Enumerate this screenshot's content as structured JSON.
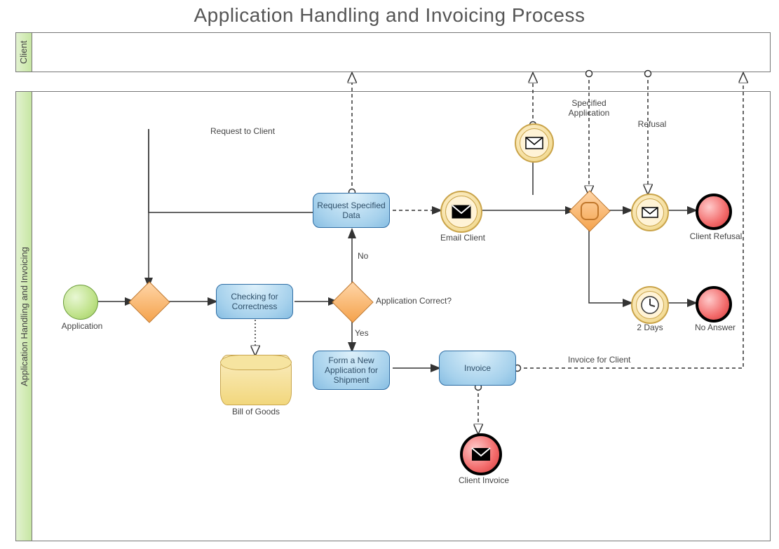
{
  "diagram": {
    "title": "Application Handling and Invoicing Process",
    "lanes": {
      "client": "Client",
      "main": "Application Handling and Invoicing"
    },
    "nodes": {
      "start": {
        "label": "Application"
      },
      "check": {
        "label": "Checking for Correctness"
      },
      "reqdata": {
        "label": "Request Specified Data"
      },
      "formnew": {
        "label": "Form a New Application for Shipment"
      },
      "invoice": {
        "label": "Invoice"
      },
      "billofgoods": {
        "label": "Bill of Goods"
      },
      "emailclient": {
        "label": "Email Client"
      },
      "specapp": {
        "label": "Specified Application"
      },
      "refusal": {
        "label": "Refusal"
      },
      "twodays": {
        "label": "2 Days"
      },
      "clientrefusal": {
        "label": "Client Refusal"
      },
      "noanswer": {
        "label": "No Answer"
      },
      "clientinvoice": {
        "label": "Client Invoice"
      }
    },
    "edges": {
      "reqtoclient": {
        "label": "Request to Client"
      },
      "appcorrect": {
        "label": "Application Correct?"
      },
      "no": {
        "label": "No"
      },
      "yes": {
        "label": "Yes"
      },
      "invoiceforclient": {
        "label": "Invoice for Client"
      }
    }
  }
}
